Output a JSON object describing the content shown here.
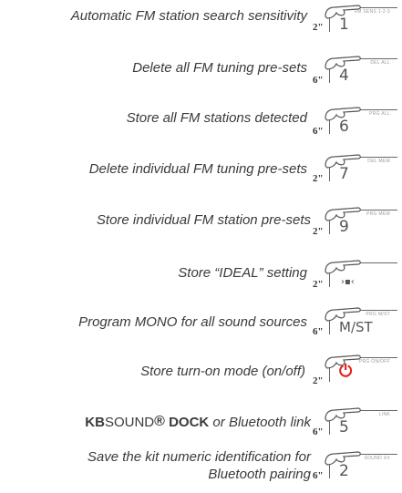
{
  "rows": [
    {
      "desc": "Automatic FM station search sensitivity",
      "hold": "2\"",
      "label": "FM SENS 1-2-3",
      "key": "1"
    },
    {
      "desc": "Delete all FM tuning pre-sets",
      "hold": "6\"",
      "label": "DEL ALL",
      "key": "4"
    },
    {
      "desc": "Store all FM stations detected",
      "hold": "6\"",
      "label": "PRG ALL",
      "key": "6"
    },
    {
      "desc": "Delete individual FM tuning pre-sets",
      "hold": "2\"",
      "label": "DEL MEM",
      "key": "7"
    },
    {
      "desc": "Store individual FM station pre-sets",
      "hold": "2\"",
      "label": "PRG MEM",
      "key": "9"
    },
    {
      "desc": "Store “IDEAL” setting",
      "hold": "2\"",
      "label": "",
      "key": "›▪‹"
    },
    {
      "desc": "Program MONO for all sound sources",
      "hold": "6\"",
      "label": "PRG M/ST",
      "key": "M/ST"
    },
    {
      "desc": "Store turn-on mode (on/off)",
      "hold": "2\"",
      "label": "PRG ON/OFF",
      "key": "⏻"
    },
    {
      "desc_kb": "KB",
      "desc_sound": "SOUND",
      "desc_reg": "®",
      "desc_dock": " DOCK",
      "desc_rest": "  or Bluetooth link",
      "hold": "6\"",
      "label": "LINK",
      "key": "5"
    },
    {
      "desc_line1": "Save the kit numeric identification for",
      "desc_line2": "Bluetooth pairing",
      "hold": "6\"",
      "label": "SOUND XX",
      "key": "2"
    }
  ],
  "colors": {
    "text": "#3a3a3a",
    "power": "#e1251b",
    "key_border": "#666666"
  },
  "icons": {
    "hand": "pointing-hand-icon",
    "power": "power-icon"
  }
}
